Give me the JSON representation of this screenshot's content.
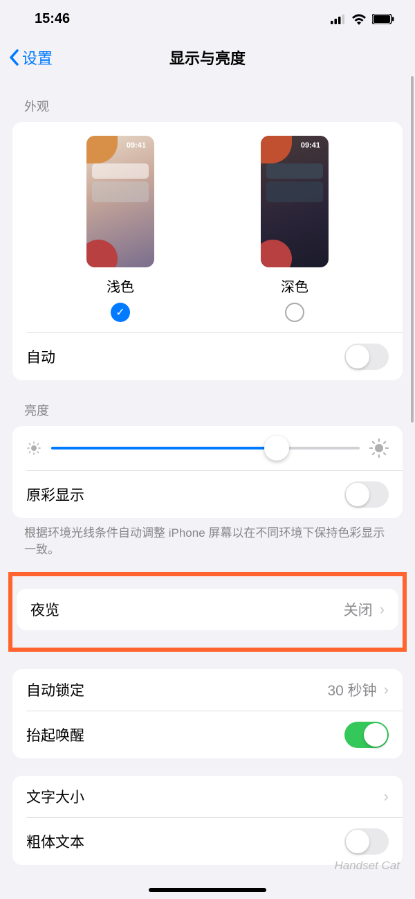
{
  "status": {
    "time": "15:46"
  },
  "nav": {
    "back": "设置",
    "title": "显示与亮度"
  },
  "appearance": {
    "header": "外观",
    "light_label": "浅色",
    "dark_label": "深色",
    "preview_time": "09:41",
    "auto_label": "自动"
  },
  "brightness": {
    "header": "亮度",
    "true_tone_label": "原彩显示",
    "footer": "根据环境光线条件自动调整 iPhone 屏幕以在不同环境下保持色彩显示一致。"
  },
  "night_shift": {
    "label": "夜览",
    "value": "关闭"
  },
  "auto_lock": {
    "label": "自动锁定",
    "value": "30 秒钟"
  },
  "raise_to_wake": {
    "label": "抬起唤醒"
  },
  "text_size": {
    "label": "文字大小"
  },
  "bold_text": {
    "label": "粗体文本"
  },
  "watermark": "Handset Cat"
}
